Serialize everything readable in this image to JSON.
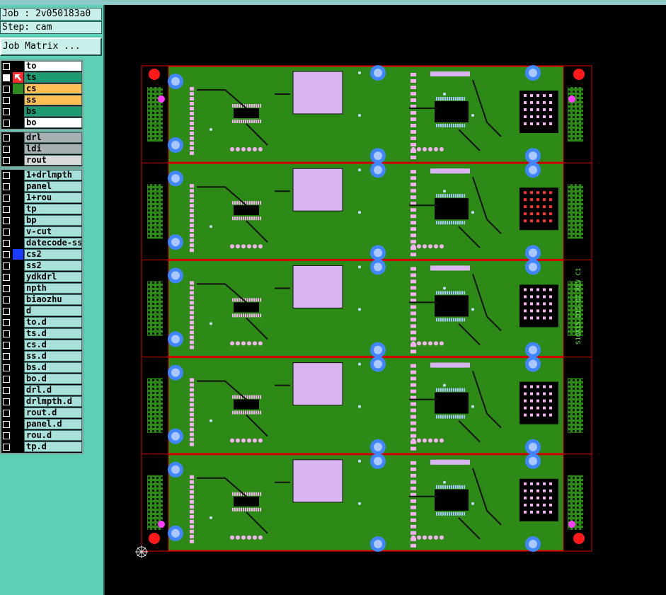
{
  "window": {
    "job_label": "Job : 2v050183a0",
    "step_label": "Step: cam",
    "job_matrix_button": "Job Matrix ..."
  },
  "colors": {
    "panel_bg": "#5ccfb4",
    "row_bg": "#a8e0dc",
    "board_green": "#2e8a16",
    "pad_pink": "#f5b3f2",
    "via_blue": "#3f86ff",
    "outline_red": "#e00000"
  },
  "layers_signal": [
    {
      "name": "to",
      "checked": false,
      "bg": "#ffffff",
      "swatch": "#000000"
    },
    {
      "name": "ts",
      "checked": true,
      "bg": "#1c9a72",
      "swatch": "#ff2020",
      "active": true
    },
    {
      "name": "cs",
      "checked": false,
      "bg": "#ffbf55",
      "swatch": "#2c8a20"
    },
    {
      "name": "ss",
      "checked": false,
      "bg": "#ffbf55",
      "swatch": "#000000"
    },
    {
      "name": "bs",
      "checked": false,
      "bg": "#1c9a72",
      "swatch": "#000000"
    },
    {
      "name": "bo",
      "checked": false,
      "bg": "#ffffff",
      "swatch": "#000000"
    }
  ],
  "layers_drill": [
    {
      "name": "drl",
      "checked": false,
      "bg": "#a9b0b3",
      "swatch": "#000000"
    },
    {
      "name": "ldi",
      "checked": false,
      "bg": "#a9b0b3",
      "swatch": "#000000"
    },
    {
      "name": "rout",
      "checked": false,
      "bg": "#d9d9d9",
      "swatch": "#000000"
    }
  ],
  "layers_misc": [
    {
      "name": "1+drlmpth",
      "checked": false,
      "swatch": "#000000"
    },
    {
      "name": "panel",
      "checked": false,
      "swatch": "#000000"
    },
    {
      "name": "1+rou",
      "checked": false,
      "swatch": "#000000"
    },
    {
      "name": "tp",
      "checked": false,
      "swatch": "#000000"
    },
    {
      "name": "bp",
      "checked": false,
      "swatch": "#000000"
    },
    {
      "name": "v-cut",
      "checked": false,
      "swatch": "#000000"
    },
    {
      "name": "datecode-ss",
      "checked": false,
      "swatch": "#000000"
    },
    {
      "name": "cs2",
      "checked": false,
      "swatch": "#1a3cff"
    },
    {
      "name": "ss2",
      "checked": false,
      "swatch": "#000000"
    },
    {
      "name": "ydkdrl",
      "checked": false,
      "swatch": "#000000"
    },
    {
      "name": "npth",
      "checked": false,
      "swatch": "#000000"
    },
    {
      "name": "biaozhu",
      "checked": false,
      "swatch": "#000000"
    },
    {
      "name": "d",
      "checked": false,
      "swatch": "#000000"
    },
    {
      "name": "to.d",
      "checked": false,
      "swatch": "#000000"
    },
    {
      "name": "ts.d",
      "checked": false,
      "swatch": "#000000"
    },
    {
      "name": "cs.d",
      "checked": false,
      "swatch": "#000000"
    },
    {
      "name": "ss.d",
      "checked": false,
      "swatch": "#000000"
    },
    {
      "name": "bs.d",
      "checked": false,
      "swatch": "#000000"
    },
    {
      "name": "bo.d",
      "checked": false,
      "swatch": "#000000"
    },
    {
      "name": "drl.d",
      "checked": false,
      "swatch": "#000000"
    },
    {
      "name": "drlmpth.d",
      "checked": false,
      "swatch": "#000000"
    },
    {
      "name": "rout.d",
      "checked": false,
      "swatch": "#000000"
    },
    {
      "name": "panel.d",
      "checked": false,
      "swatch": "#000000"
    },
    {
      "name": "rou.d",
      "checked": false,
      "swatch": "#000000"
    },
    {
      "name": "tp.d",
      "checked": false,
      "swatch": "#000000"
    }
  ],
  "board": {
    "panel_count": 5,
    "silkscreen_text": "S10A15-D15-02  REV C1"
  }
}
